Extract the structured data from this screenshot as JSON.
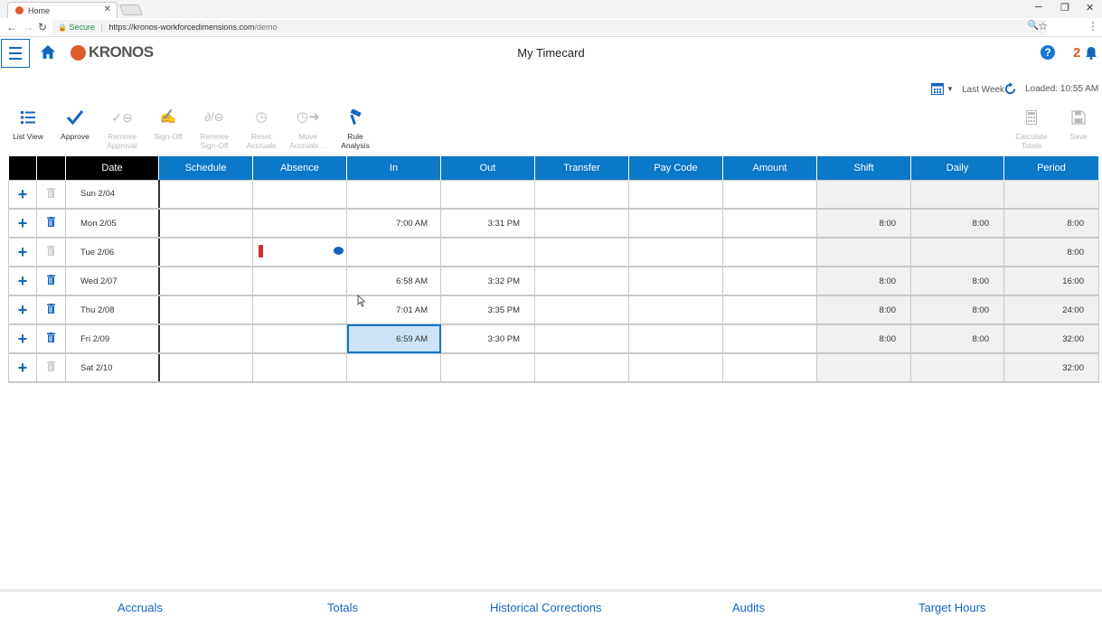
{
  "browser": {
    "tab_title": "Home",
    "secure_label": "Secure",
    "url_host": "https://kronos-workforcedimensions.com",
    "url_path": "/demo"
  },
  "header": {
    "logo_text": "KRONOS",
    "title": "My Timecard",
    "notification_count": "2"
  },
  "period": {
    "label": "Last Week",
    "loaded": "Loaded: 10:55 AM"
  },
  "toolbar": {
    "list_view": "List View",
    "approve": "Approve",
    "remove_approval_1": "Remove",
    "remove_approval_2": "Approval",
    "sign_off": "Sign-Off",
    "remove_signoff_1": "Remove",
    "remove_signoff_2": "Sign-Off",
    "reset_accruals_1": "Reset",
    "reset_accruals_2": "Accruals",
    "move_accruals_1": "Move",
    "move_accruals_2": "Accruals ...",
    "rule_analysis_1": "Rule",
    "rule_analysis_2": "Analysis",
    "calculate_totals_1": "Calculate",
    "calculate_totals_2": "Totals",
    "save": "Save"
  },
  "grid": {
    "columns": {
      "date": "Date",
      "schedule": "Schedule",
      "absence": "Absence",
      "in": "In",
      "out": "Out",
      "transfer": "Transfer",
      "pay_code": "Pay Code",
      "amount": "Amount",
      "shift": "Shift",
      "daily": "Daily",
      "period": "Period"
    },
    "rows": [
      {
        "date": "Sun 2/04",
        "in": "",
        "out": "",
        "shift": "",
        "daily": "",
        "period": ""
      },
      {
        "date": "Mon 2/05",
        "in": "7:00 AM",
        "out": "3:31 PM",
        "shift": "8:00",
        "daily": "8:00",
        "period": "8:00"
      },
      {
        "date": "Tue 2/06",
        "in": "",
        "out": "",
        "shift": "",
        "daily": "",
        "period": "8:00"
      },
      {
        "date": "Wed 2/07",
        "in": "6:58 AM",
        "out": "3:32 PM",
        "shift": "8:00",
        "daily": "8:00",
        "period": "16:00"
      },
      {
        "date": "Thu 2/08",
        "in": "7:01 AM",
        "out": "3:35 PM",
        "shift": "8:00",
        "daily": "8:00",
        "period": "24:00"
      },
      {
        "date": "Fri 2/09",
        "in": "6:59 AM",
        "out": "3:30 PM",
        "shift": "8:00",
        "daily": "8:00",
        "period": "32:00"
      },
      {
        "date": "Sat 2/10",
        "in": "",
        "out": "",
        "shift": "",
        "daily": "",
        "period": "32:00"
      }
    ]
  },
  "bottom_tabs": {
    "accruals": "Accruals",
    "totals": "Totals",
    "historical_corrections": "Historical Corrections",
    "audits": "Audits",
    "target_hours": "Target Hours"
  },
  "colors": {
    "accent_blue": "#0b78c8",
    "brand_orange": "#e05a2b",
    "absence_red": "#d32f2f"
  }
}
